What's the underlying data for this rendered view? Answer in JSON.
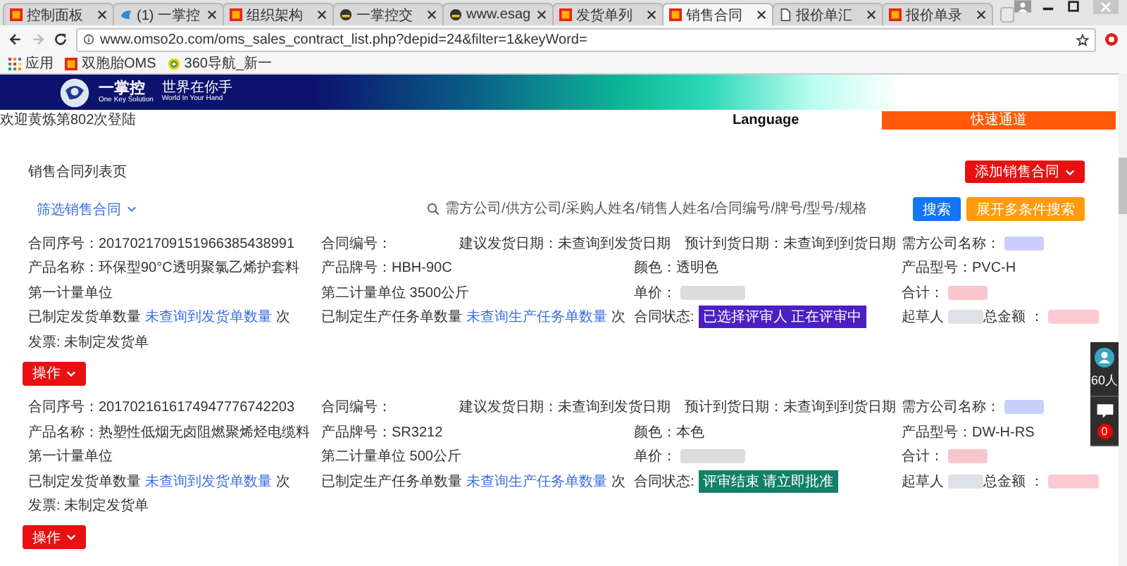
{
  "browser": {
    "tabs": [
      {
        "title": "控制面板",
        "kind": "tile",
        "selected": false
      },
      {
        "title": "(1) 一掌控",
        "kind": "bird",
        "selected": false
      },
      {
        "title": "组织架构",
        "kind": "tile",
        "selected": false
      },
      {
        "title": "一掌控交",
        "kind": "badge",
        "selected": false
      },
      {
        "title": "www.esag",
        "kind": "badge",
        "selected": false
      },
      {
        "title": "发货单列",
        "kind": "tile",
        "selected": false
      },
      {
        "title": "销售合同",
        "kind": "tile",
        "selected": true
      },
      {
        "title": "报价单汇",
        "kind": "page",
        "selected": false
      },
      {
        "title": "报价单录",
        "kind": "tile",
        "selected": false
      }
    ],
    "address": "www.omso2o.com/oms_sales_contract_list.php?depid=24&filter=1&keyWord=",
    "bookmarks": [
      {
        "label": "应用",
        "kind": "apps"
      },
      {
        "label": "双胞胎OMS",
        "kind": "tile"
      },
      {
        "label": "360导航_新一",
        "kind": "globe"
      }
    ]
  },
  "header": {
    "logo": {
      "name": "一掌控",
      "slogan": "世界在你手",
      "name_en": "One Key Solution",
      "slogan_en": "World In Your Hand"
    },
    "welcome": "欢迎黄炼第802次登陆",
    "language": "Language",
    "quick_link": "快速通道"
  },
  "page": {
    "title": "销售合同列表页",
    "add_button": "添加销售合同",
    "filter_link": "筛选销售合同",
    "search": {
      "placeholder": "需方公司/供方公司/采购人姓名/销售人姓名/合同编号/牌号/型号/规格"
    },
    "search_button": "搜索",
    "advanced_button": "展开多条件搜索"
  },
  "contracts": [
    {
      "rows": [
        [
          {
            "text": "合同序号：2017021709151966385438991"
          },
          {
            "text": "合同编号："
          },
          {
            "text": "建议发货日期：未查询到发货日期"
          },
          "",
          {
            "text": "预计到货日期：未查询到到货日期"
          },
          {
            "text": "需方公司名称：",
            "color": "#c9cffa"
          }
        ],
        [
          {
            "text": "产品名称：环保型90°C透明聚氯乙烯护套料"
          },
          {
            "text": "产品牌号：HBH-90C"
          },
          "",
          {
            "text": "颜色：透明色"
          },
          "",
          {
            "text": "产品型号：PVC-H"
          }
        ],
        [
          {
            "text": "第一计量单位"
          },
          {
            "text": "第二计量单位 3500公斤"
          },
          "",
          {
            "text": "单价：",
            "color": "#dcdcdc"
          },
          "",
          {
            "text": "合计：",
            "color": "#f9c6cc"
          }
        ],
        [
          {
            "text": "已制定发货单数量",
            "link": "未查询到发货单数量",
            "suffix": "次"
          },
          {
            "text": "已制定生产任务单数量",
            "link": "未查询生产任务单数量",
            "suffix": "次"
          },
          "",
          {
            "text": "合同状态:",
            "status": {
              "text": "已选择评审人 正在评审中",
              "color": "#4b1fc4"
            }
          },
          "",
          {
            "text": "起草人",
            "color": "#dde2ea"
          },
          {
            "text": "总金额 ：",
            "color": "#fbc9cf"
          }
        ],
        [
          {
            "text": "发票: 未制定发货单"
          }
        ]
      ],
      "action_button": "操作"
    },
    {
      "rows": [
        [
          {
            "text": "合同序号：2017021616174947776742203"
          },
          {
            "text": "合同编号："
          },
          {
            "text": "建议发货日期：未查询到发货日期"
          },
          "",
          {
            "text": "预计到货日期：未查询到到货日期"
          },
          {
            "text": "需方公司名称：",
            "color": "#c9cffa"
          }
        ],
        [
          {
            "text": "产品名称：热塑性低烟无卤阻燃聚烯烃电缆料"
          },
          {
            "text": "产品牌号：SR3212"
          },
          "",
          {
            "text": "颜色：本色"
          },
          "",
          {
            "text": "产品型号：DW-H-RS"
          }
        ],
        [
          {
            "text": "第一计量单位"
          },
          {
            "text": "第二计量单位 500公斤"
          },
          "",
          {
            "text": "单价：",
            "color": "#dcdcdc"
          },
          "",
          {
            "text": "合计：",
            "color": "#f9c6cc"
          }
        ],
        [
          {
            "text": "已制定发货单数量",
            "link": "未查询到发货单数量",
            "suffix": "次"
          },
          {
            "text": "已制定生产任务单数量",
            "link": "未查询生产任务单数量",
            "suffix": "次"
          },
          "",
          {
            "text": "合同状态:",
            "status": {
              "text": "评审结束 请立即批准",
              "color": "#14806a"
            }
          },
          "",
          {
            "text": "起草人",
            "color": "#dde2ea"
          },
          {
            "text": "总金额 ：",
            "color": "#fbc9cf"
          }
        ],
        [
          {
            "text": "发票: 未制定发货单"
          }
        ]
      ],
      "action_button": "操作"
    }
  ],
  "side_widget": {
    "online": "60人",
    "messages": "0"
  }
}
